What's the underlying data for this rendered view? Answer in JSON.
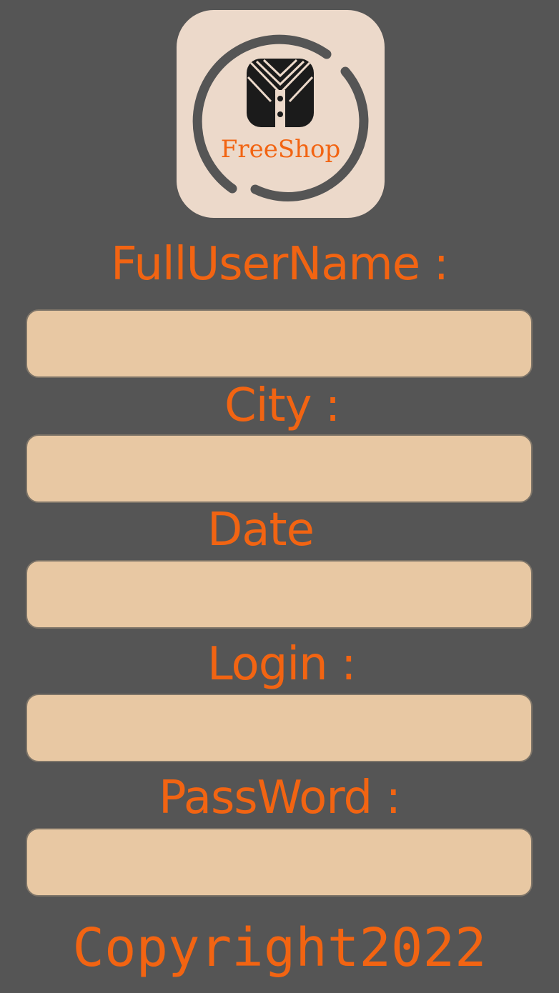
{
  "app": {
    "brand": "FreeShop",
    "logo_icon": "shirt-icon",
    "colors": {
      "background": "#555555",
      "accent": "#f26412",
      "field_fill": "#e8c8a3",
      "logo_bg": "#ecd9ca"
    }
  },
  "form": {
    "full_user_name_label": "FullUserName :",
    "full_user_name_value": "",
    "city_label": "City :",
    "city_value": "",
    "date_label": "Date",
    "date_value": "",
    "login_label": "Login :",
    "login_value": "",
    "password_label": "PassWord :",
    "password_value": ""
  },
  "footer": {
    "copyright": "Copyright2022"
  }
}
